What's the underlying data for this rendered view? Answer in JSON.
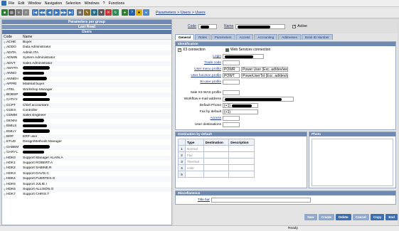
{
  "menu": [
    "File",
    "Edit",
    "Window",
    "Navigation",
    "Selection",
    "Windows",
    "?",
    "Functions"
  ],
  "toolbar": {
    "breadcrumb": "Parameters > Users > Users"
  },
  "left_panel": {
    "headers": [
      "Parameters per group",
      "Last Read",
      "Users"
    ],
    "columns": [
      "Code",
      "Name"
    ],
    "rows": [
      {
        "code": "ACHE",
        "name": "Buyer"
      },
      {
        "code": "ADDO",
        "name": "Data Administrator"
      },
      {
        "code": "ADITA",
        "name": "Admin ITA"
      },
      {
        "code": "ADMIN",
        "name": "System Administrator"
      },
      {
        "code": "ADVT",
        "name": "Sales Administrator"
      },
      {
        "code": "AMYPA",
        "name": ""
      },
      {
        "code": "ANNO",
        "name": ""
      },
      {
        "code": "ANNEH",
        "name": ""
      },
      {
        "code": "APPRI",
        "name": "Material buyer"
      },
      {
        "code": "ATEL",
        "name": "Workshop Manager"
      },
      {
        "code": "BOBSP",
        "name": ""
      },
      {
        "code": "CATHY",
        "name": ""
      },
      {
        "code": "CCPT",
        "name": "Chief accountant"
      },
      {
        "code": "CGES",
        "name": "Controller"
      },
      {
        "code": "CDMM",
        "name": "Sales Engineer"
      },
      {
        "code": "DENNI",
        "name": ""
      },
      {
        "code": "EMILS",
        "name": ""
      },
      {
        "code": "EMILY",
        "name": ""
      },
      {
        "code": "ERP",
        "name": "ERP user"
      },
      {
        "code": "ETUD",
        "name": "Design/Methods Manager"
      },
      {
        "code": "GABEM",
        "name": ""
      },
      {
        "code": "GARYL",
        "name": ""
      },
      {
        "code": "HDK0",
        "name": "Support Manager ALAIN.A"
      },
      {
        "code": "HDK1",
        "name": "Support ROBERT.A"
      },
      {
        "code": "HDK2",
        "name": "Support SABINE.R"
      },
      {
        "code": "HDK3",
        "name": "Support DAVIS.C"
      },
      {
        "code": "HDK4",
        "name": "Support FUERTES.G"
      },
      {
        "code": "HDK5",
        "name": "Support JULIE.I"
      },
      {
        "code": "HDK6",
        "name": "Support ALLISON.O"
      },
      {
        "code": "HDK7",
        "name": "Support CHRIS.T"
      }
    ]
  },
  "top_fields": {
    "code_label": "Code",
    "name_label": "Name",
    "active_label": "Active"
  },
  "tabs": [
    "General",
    "Roles",
    "Parameters",
    "Access",
    "Accounting",
    "Addresses",
    "Book ID Number"
  ],
  "identification": {
    "title": "Identification",
    "x3_connection": "X3 connection",
    "web_services": "Web Services connection",
    "login": "Login",
    "trade_code": "Trade code",
    "user_menu_profile": "User menu profile",
    "menu_profile_code": "POWR",
    "menu_profile_desc": "Power User (Exc. ad/dev/wel)",
    "user_function_profile": "User function profile",
    "function_profile_code": "POWT",
    "function_profile_desc": "PowerUserTst (Exc. ad/dev/we",
    "bi_user_profile": "BI user profile",
    "sales_profile": "Sale X3 WAS profile",
    "workflow_email": "Workflow e-mail address",
    "default_phone": "Default Phone",
    "default_phone_value": "(+1)",
    "fax_default": "Fax by default",
    "fax_default_value": "(+1)",
    "access": "Access",
    "user_destinations": "User destinations"
  },
  "destination": {
    "title": "Destination by default",
    "columns": [
      "Type",
      "Destination",
      "Description"
    ],
    "rows": [
      {
        "n": "1",
        "type": "Normal"
      },
      {
        "n": "2",
        "type": "Fax"
      },
      {
        "n": "3",
        "type": "Thermal"
      },
      {
        "n": "4",
        "type": "color"
      },
      {
        "n": "5",
        "type": ""
      }
    ]
  },
  "photo": {
    "title": "Photo"
  },
  "misc": {
    "title": "Miscellaneous",
    "title_bar": "Title bar"
  },
  "buttons": [
    "New",
    "Create",
    "Delete",
    "Cancel",
    "Copy",
    "End"
  ],
  "status": {
    "text": "Ready"
  }
}
